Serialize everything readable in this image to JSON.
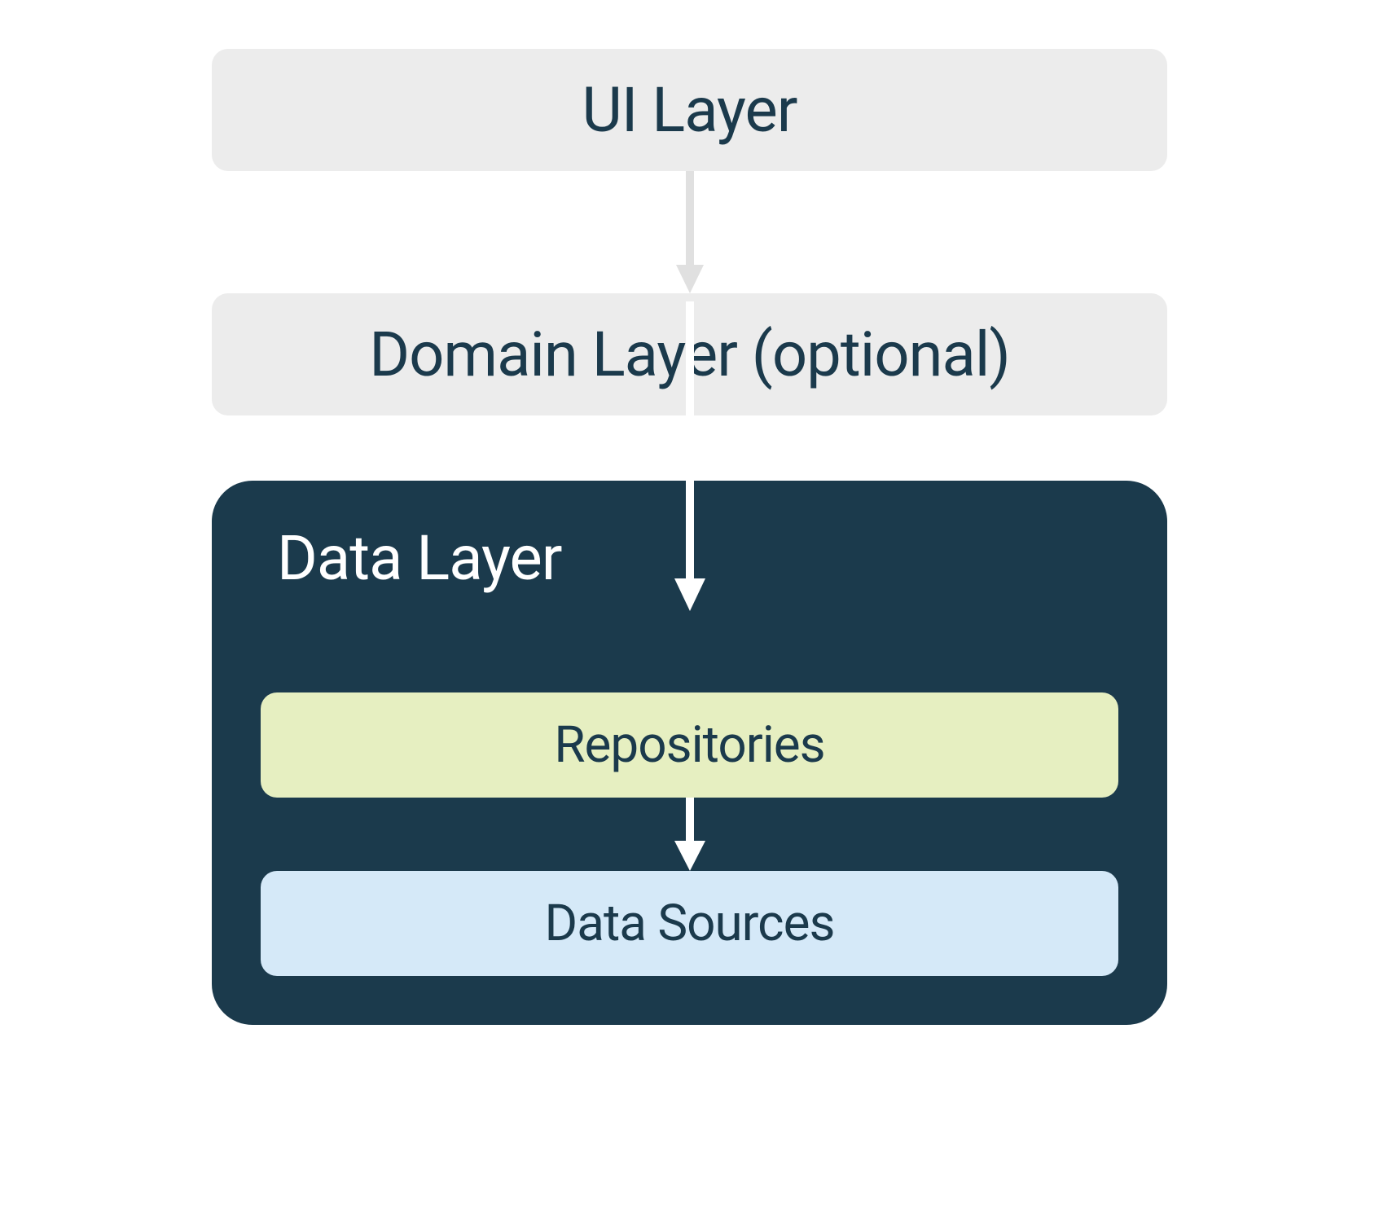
{
  "diagram": {
    "layers": {
      "ui": {
        "label": "UI Layer"
      },
      "domain": {
        "label": "Domain Layer (optional)"
      },
      "data": {
        "label": "Data Layer",
        "sublayers": {
          "repositories": {
            "label": "Repositories"
          },
          "data_sources": {
            "label": "Data Sources"
          }
        }
      }
    },
    "arrows": [
      {
        "from": "ui",
        "to": "domain",
        "color": "#e0e0e0"
      },
      {
        "from": "domain",
        "to": "data.repositories",
        "color": "#ffffff"
      },
      {
        "from": "data.repositories",
        "to": "data.data_sources",
        "color": "#ffffff"
      }
    ],
    "colors": {
      "light_box": "#ececec",
      "dark_container": "#1b3a4c",
      "repositories": "#e6efc1",
      "data_sources": "#d5e9f8",
      "text_dark": "#1b3a4c",
      "text_light": "#ffffff",
      "arrow_light": "#e0e0e0",
      "arrow_white": "#ffffff"
    }
  }
}
